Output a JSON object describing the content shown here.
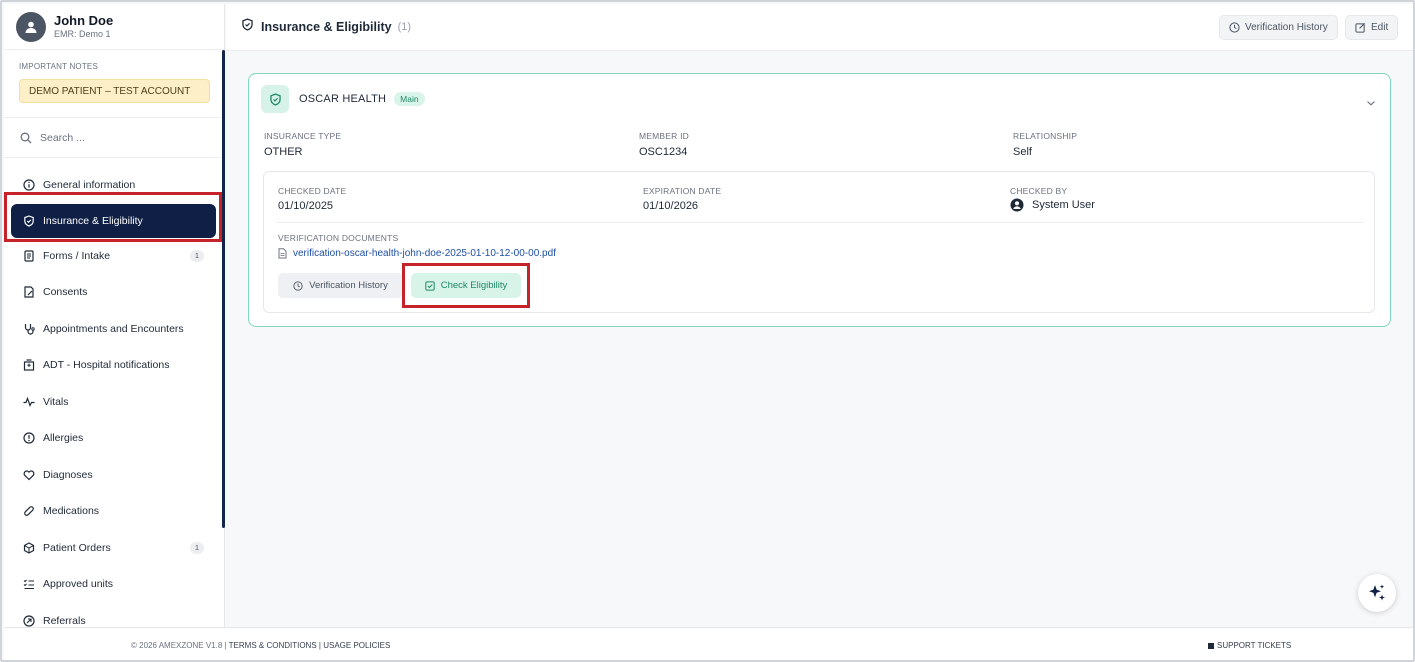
{
  "patient": {
    "name": "John Doe",
    "emr": "EMR: Demo 1"
  },
  "notes": {
    "label": "IMPORTANT NOTES",
    "badge": "DEMO PATIENT – TEST ACCOUNT"
  },
  "search": {
    "placeholder": "Search ..."
  },
  "sidebar": {
    "items": [
      {
        "label": "General information",
        "icon": "info-icon"
      },
      {
        "label": "Insurance & Eligibility",
        "icon": "shield-icon",
        "active": true
      },
      {
        "label": "Forms / Intake",
        "icon": "document-icon",
        "badge": "1"
      },
      {
        "label": "Consents",
        "icon": "consent-icon"
      },
      {
        "label": "Appointments and Encounters",
        "icon": "stethoscope-icon"
      },
      {
        "label": "ADT - Hospital notifications",
        "icon": "hospital-icon"
      },
      {
        "label": "Vitals",
        "icon": "pulse-icon"
      },
      {
        "label": "Allergies",
        "icon": "alert-icon"
      },
      {
        "label": "Diagnoses",
        "icon": "heart-icon"
      },
      {
        "label": "Medications",
        "icon": "pill-icon"
      },
      {
        "label": "Patient Orders",
        "icon": "box-icon",
        "badge": "1"
      },
      {
        "label": "Approved units",
        "icon": "checklist-icon"
      },
      {
        "label": "Referrals",
        "icon": "referral-icon"
      }
    ]
  },
  "header": {
    "title": "Insurance & Eligibility",
    "count": "(1)",
    "history_label": "Verification History",
    "edit_label": "Edit"
  },
  "insurance": {
    "carrier": "OSCAR HEALTH",
    "badge": "Main",
    "type_label": "INSURANCE TYPE",
    "type_value": "OTHER",
    "member_label": "MEMBER ID",
    "member_value": "OSC1234",
    "relationship_label": "RELATIONSHIP",
    "relationship_value": "Self",
    "checked_date_label": "CHECKED DATE",
    "checked_date_value": "01/10/2025",
    "expiration_label": "EXPIRATION DATE",
    "expiration_value": "01/10/2026",
    "checked_by_label": "CHECKED BY",
    "checked_by_value": "System User",
    "docs_label": "VERIFICATION DOCUMENTS",
    "doc_file": "verification-oscar-health-john-doe-2025-01-10-12-00-00.pdf",
    "history_button": "Verification History",
    "check_button": "Check Eligibility"
  },
  "footer": {
    "copyright": "© 2026 AMEXZONE V1.8 |",
    "terms": "TERMS & CONDITIONS",
    "sep": "|",
    "usage": "USAGE POLICIES",
    "support": "SUPPORT TICKETS"
  },
  "colors": {
    "accent": "#0f1f45",
    "highlight": "#c6222a",
    "teal": "#1e8a67"
  }
}
